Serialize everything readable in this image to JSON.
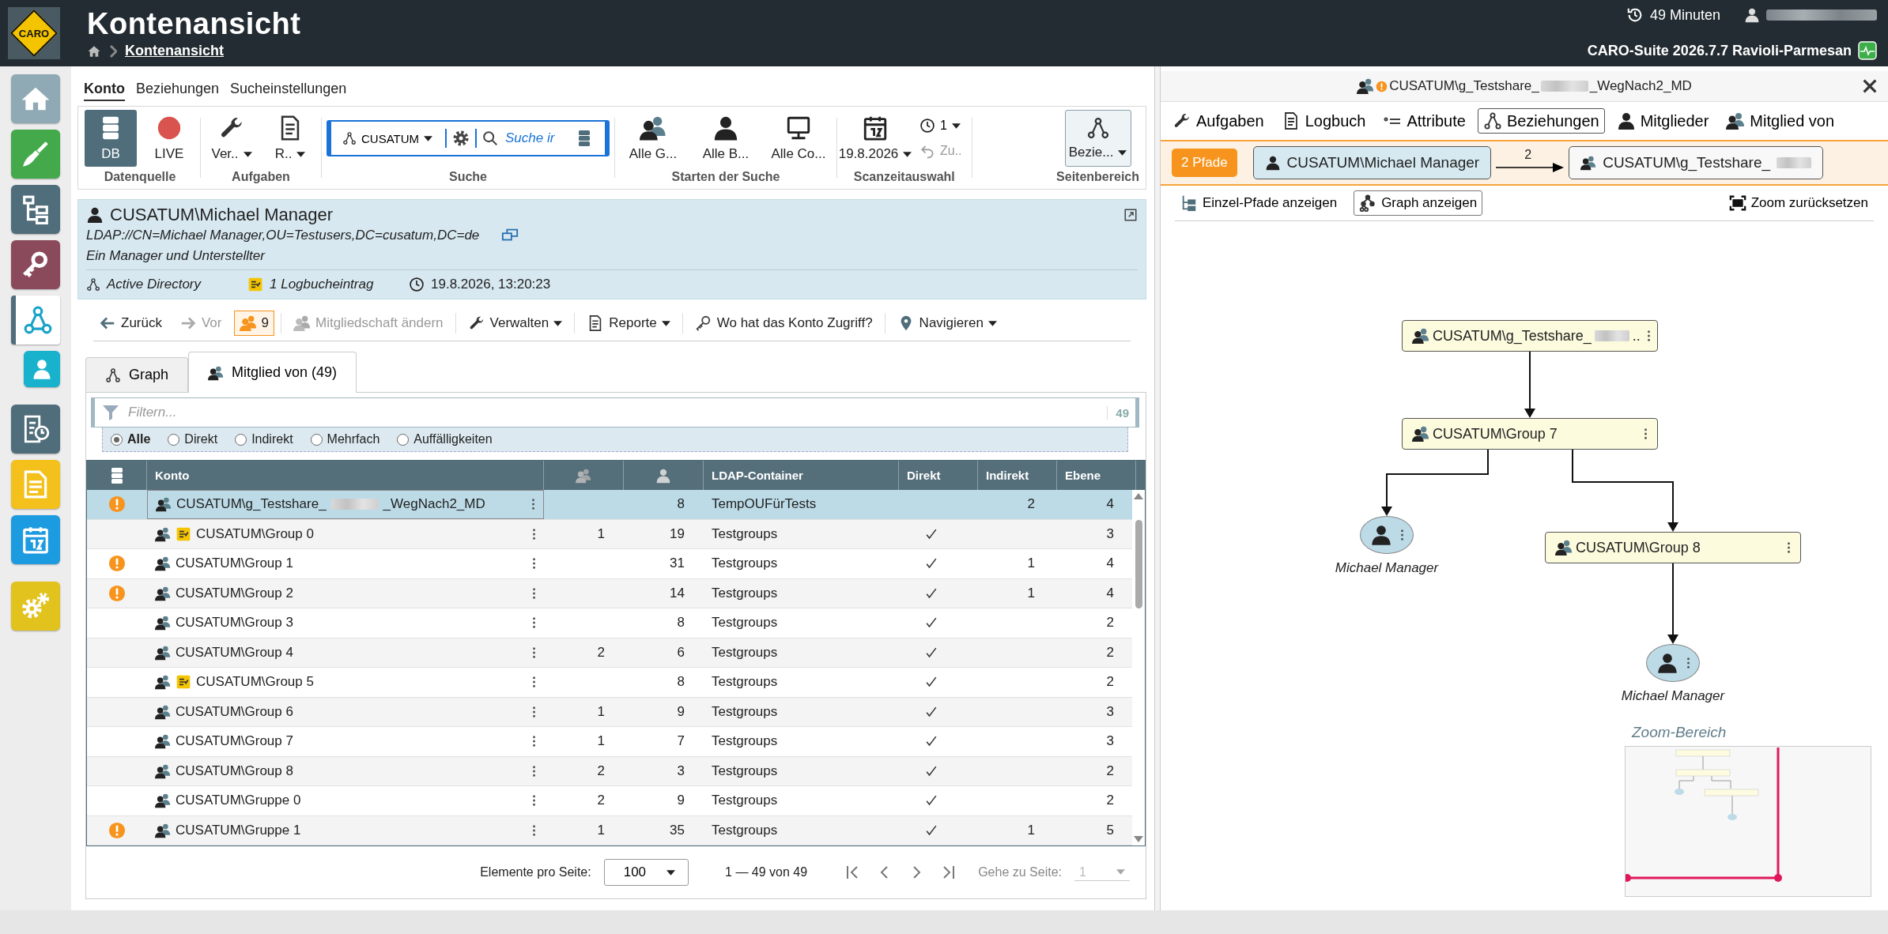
{
  "header": {
    "logo": "CARO",
    "title": "Kontenansicht",
    "breadcrumb": "Kontenansicht",
    "session": "49 Minuten",
    "version": "CARO-Suite 2026.7.7 Ravioli-Parmesan"
  },
  "sidebar": {
    "items": [
      {
        "kind": "home",
        "selected": false
      },
      {
        "kind": "cleanup",
        "selected": false
      },
      {
        "kind": "tree",
        "selected": false
      },
      {
        "kind": "key",
        "selected": false
      },
      {
        "kind": "graph",
        "selected": true
      },
      {
        "kind": "user",
        "selected": false
      },
      {
        "kind": "report",
        "selected": false
      },
      {
        "kind": "document",
        "selected": false
      },
      {
        "kind": "calendar",
        "selected": false
      },
      {
        "kind": "settings",
        "selected": false
      }
    ]
  },
  "menu_tabs": [
    {
      "label": "Konto",
      "selected": true
    },
    {
      "label": "Beziehungen",
      "selected": false
    },
    {
      "label": "Sucheinstellungen",
      "selected": false
    }
  ],
  "ribbon": {
    "datasource": {
      "caption": "Datenquelle",
      "buttons": [
        {
          "label": "DB",
          "kind": "db",
          "selected": true
        },
        {
          "label": "LIVE",
          "kind": "live",
          "selected": false
        }
      ]
    },
    "tasks": {
      "caption": "Aufgaben",
      "buttons": [
        {
          "label": "Ver..",
          "kind": "wrench"
        },
        {
          "label": "R..",
          "kind": "report"
        }
      ]
    },
    "search": {
      "caption": "Suche",
      "domain": "CUSATUM",
      "placeholder": "Suche ir"
    },
    "start": {
      "caption": "Starten der Suche",
      "buttons": [
        {
          "label": "Alle G...",
          "kind": "group"
        },
        {
          "label": "Alle B...",
          "kind": "user"
        },
        {
          "label": "Alle Co...",
          "kind": "computer"
        }
      ]
    },
    "scantime": {
      "caption": "Scanzeitauswahl",
      "date": "19.8.2026",
      "count": "1",
      "back": "Zu..",
      "back_disabled": true
    },
    "page": {
      "caption": "Seitenbereich",
      "label": "Bezie...",
      "selected": true
    }
  },
  "account": {
    "name": "CUSATUM\\Michael Manager",
    "ldap": "LDAP://CN=Michael Manager,OU=Testusers,DC=cusatum,DC=de",
    "description": "Ein Manager und Unterstellter",
    "source": "Active Directory",
    "log": "1 Logbucheintrag",
    "timestamp": "19.8.2026, 13:20:23"
  },
  "actions": [
    {
      "kind": "back",
      "label": "Zurück",
      "disabled": false
    },
    {
      "kind": "forward",
      "label": "Vor",
      "disabled": true
    },
    {
      "kind": "count",
      "label": "9",
      "disabled": false
    },
    {
      "kind": "membership",
      "label": "Mitgliedschaft ändern",
      "disabled": true
    },
    {
      "kind": "manage",
      "label": "Verwalten",
      "disabled": false
    },
    {
      "kind": "reports",
      "label": "Reporte",
      "disabled": false
    },
    {
      "kind": "access",
      "label": "Wo hat das Konto Zugriff?",
      "disabled": false
    },
    {
      "kind": "navigate",
      "label": "Navigieren",
      "disabled": false
    }
  ],
  "view_tabs": [
    {
      "label": "Graph",
      "kind": "graph",
      "selected": false
    },
    {
      "label": "Mitglied von (49)",
      "kind": "group",
      "selected": true
    }
  ],
  "filter": {
    "placeholder": "Filtern...",
    "count": "49",
    "options": [
      {
        "label": "Alle",
        "selected": true
      },
      {
        "label": "Direkt",
        "selected": false
      },
      {
        "label": "Indirekt",
        "selected": false
      },
      {
        "label": "Mehrfach",
        "selected": false
      },
      {
        "label": "Auffälligkeiten",
        "selected": false
      }
    ]
  },
  "table": {
    "columns": [
      {
        "kind": "icon"
      },
      {
        "kind": "text",
        "label": "Konto"
      },
      {
        "kind": "groups"
      },
      {
        "kind": "users"
      },
      {
        "kind": "text",
        "label": "LDAP-Container"
      },
      {
        "kind": "text",
        "label": "Direkt"
      },
      {
        "kind": "text",
        "label": "Indirekt"
      },
      {
        "kind": "text",
        "label": "Ebene"
      }
    ],
    "rows": [
      {
        "warning": true,
        "log": false,
        "name": "CUSATUM\\g_Testshare_",
        "redacted": true,
        "name_end": "_WegNach2_MD",
        "users": "8",
        "container": "TempOUFürTests",
        "direct": false,
        "indirect": "2",
        "level": "4",
        "selected": true
      },
      {
        "warning": false,
        "log": true,
        "name": "CUSATUM\\Group 0",
        "groups": "1",
        "users": "19",
        "container": "Testgroups",
        "direct": true,
        "level": "3",
        "selected": false
      },
      {
        "warning": true,
        "log": false,
        "name": "CUSATUM\\Group 1",
        "users": "31",
        "container": "Testgroups",
        "direct": true,
        "indirect": "1",
        "level": "4",
        "selected": false
      },
      {
        "warning": true,
        "log": false,
        "name": "CUSATUM\\Group 2",
        "users": "14",
        "container": "Testgroups",
        "direct": true,
        "indirect": "1",
        "level": "4",
        "selected": false
      },
      {
        "warning": false,
        "log": false,
        "name": "CUSATUM\\Group 3",
        "users": "8",
        "container": "Testgroups",
        "direct": true,
        "level": "2",
        "selected": false
      },
      {
        "warning": false,
        "log": false,
        "name": "CUSATUM\\Group 4",
        "groups": "2",
        "users": "6",
        "container": "Testgroups",
        "direct": true,
        "level": "2",
        "selected": false
      },
      {
        "warning": false,
        "log": true,
        "name": "CUSATUM\\Group 5",
        "users": "8",
        "container": "Testgroups",
        "direct": true,
        "level": "2",
        "selected": false
      },
      {
        "warning": false,
        "log": false,
        "name": "CUSATUM\\Group 6",
        "groups": "1",
        "users": "9",
        "container": "Testgroups",
        "direct": true,
        "level": "3",
        "selected": false
      },
      {
        "warning": false,
        "log": false,
        "name": "CUSATUM\\Group 7",
        "groups": "1",
        "users": "7",
        "container": "Testgroups",
        "direct": true,
        "level": "3",
        "selected": false
      },
      {
        "warning": false,
        "log": false,
        "name": "CUSATUM\\Group 8",
        "groups": "2",
        "users": "3",
        "container": "Testgroups",
        "direct": true,
        "level": "2",
        "selected": false
      },
      {
        "warning": false,
        "log": false,
        "name": "CUSATUM\\Gruppe 0",
        "groups": "2",
        "users": "9",
        "container": "Testgroups",
        "direct": true,
        "level": "2",
        "selected": false
      },
      {
        "warning": true,
        "log": false,
        "name": "CUSATUM\\Gruppe 1",
        "groups": "1",
        "users": "35",
        "container": "Testgroups",
        "direct": true,
        "indirect": "1",
        "level": "5",
        "selected": false
      }
    ]
  },
  "pagination": {
    "page_size_label": "Elemente pro Seite:",
    "page_size": "100",
    "range": "1 — 49 von 49",
    "goto_label": "Gehe zu Seite:",
    "goto": "1"
  },
  "detail": {
    "title": "CUSATUM\\g_Testshare_",
    "redacted": true,
    "title_end": "_WegNach2_MD",
    "warning": true,
    "tabs": [
      {
        "label": "Aufgaben",
        "kind": "wrench",
        "selected": false
      },
      {
        "label": "Logbuch",
        "kind": "log",
        "selected": false
      },
      {
        "label": "Attribute",
        "kind": "list",
        "selected": false
      },
      {
        "label": "Beziehungen",
        "kind": "graph",
        "selected": true
      },
      {
        "label": "Mitglieder",
        "kind": "user",
        "selected": false
      },
      {
        "label": "Mitglied von",
        "kind": "group",
        "selected": false
      }
    ],
    "paths": {
      "count": "2 Pfade",
      "from": "CUSATUM\\Michael Manager",
      "steps": "2",
      "to": "CUSATUM\\g_Testshare_",
      "to_redacted": true
    },
    "tools": [
      {
        "label": "Einzel-Pfade anzeigen",
        "kind": "paths",
        "selected": false
      },
      {
        "label": "Graph anzeigen",
        "kind": "graph",
        "selected": true
      }
    ],
    "reset": "Zoom zurücksetzen",
    "graph": {
      "nodes": [
        {
          "kind": "group",
          "label": "CUSATUM\\g_Testshare_",
          "redacted": true,
          "label_end": ".."
        },
        {
          "kind": "group",
          "label": "CUSATUM\\Group 7"
        },
        {
          "kind": "user",
          "label": "Michael Manager"
        },
        {
          "kind": "group",
          "label": "CUSATUM\\Group 8"
        },
        {
          "kind": "user",
          "label": "Michael Manager"
        }
      ],
      "minimap_title": "Zoom-Bereich"
    }
  }
}
